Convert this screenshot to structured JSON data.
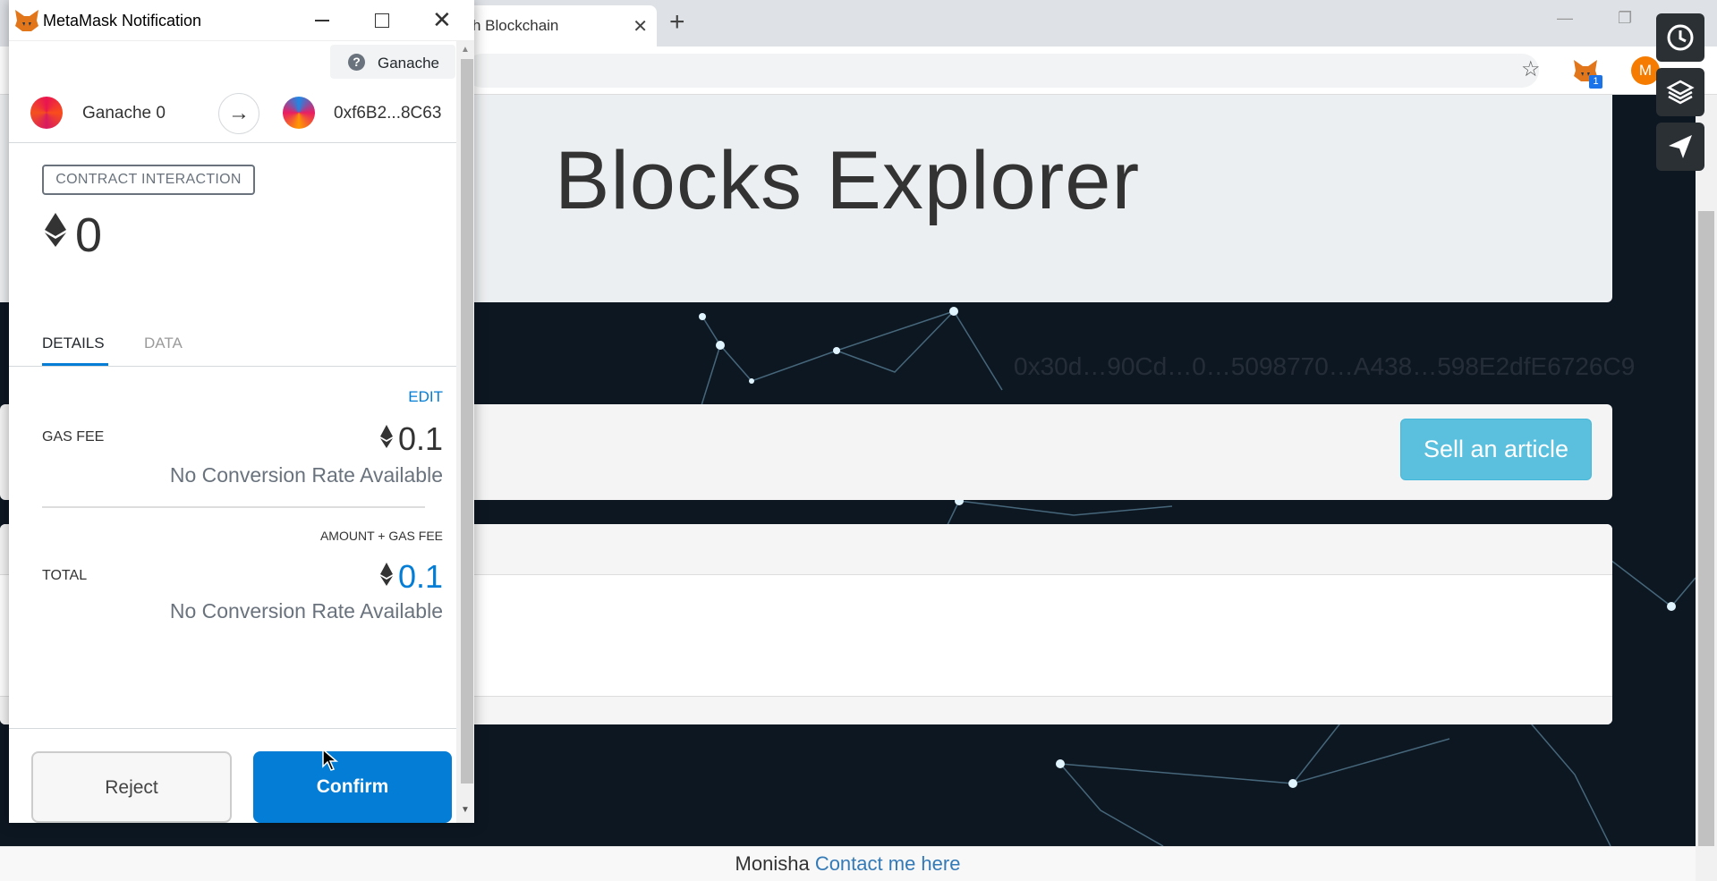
{
  "browser": {
    "tab_title": "h Blockchain",
    "tab_close": "✕",
    "new_tab": "+",
    "minimize_glyph": "—",
    "restore_glyph": "❐",
    "star_glyph": "☆",
    "extension_badge": "1",
    "profile_initial": "M"
  },
  "page": {
    "brand_title": "Blocks Explorer",
    "account_address": "0x30d…90Cd…0…5098770…A438…598E2dfE6726C9",
    "sell_button": "Sell an article",
    "footer_name": "Monisha",
    "footer_link": "Contact me here"
  },
  "metamask": {
    "window_title": "MetaMask Notification",
    "close_glyph": "✕",
    "network_icon": "?",
    "network": "Ganache",
    "from_account": "Ganache 0",
    "arrow_glyph": "→",
    "to_address": "0xf6B2...8C63",
    "interaction_badge": "CONTRACT INTERACTION",
    "amount": "0",
    "tabs": {
      "details": "DETAILS",
      "data": "DATA"
    },
    "edit": "EDIT",
    "gas_fee_label": "GAS FEE",
    "gas_fee_value": "0.1",
    "gas_conversion": "No Conversion Rate Available",
    "amount_gas_fee_label": "AMOUNT + GAS FEE",
    "total_label": "TOTAL",
    "total_value": "0.1",
    "total_conversion": "No Conversion Rate Available",
    "reject": "Reject",
    "confirm": "Confirm"
  },
  "colors": {
    "metamask_blue": "#037dd6",
    "sell_button": "#5bc0de",
    "page_background": "#0d1722",
    "footer_link": "#337ab7"
  },
  "icons": {
    "side_tools": [
      "clock-icon",
      "layers-icon",
      "send-icon"
    ],
    "toolbar": [
      "star-icon",
      "metamask-extension-icon",
      "profile-avatar"
    ]
  }
}
